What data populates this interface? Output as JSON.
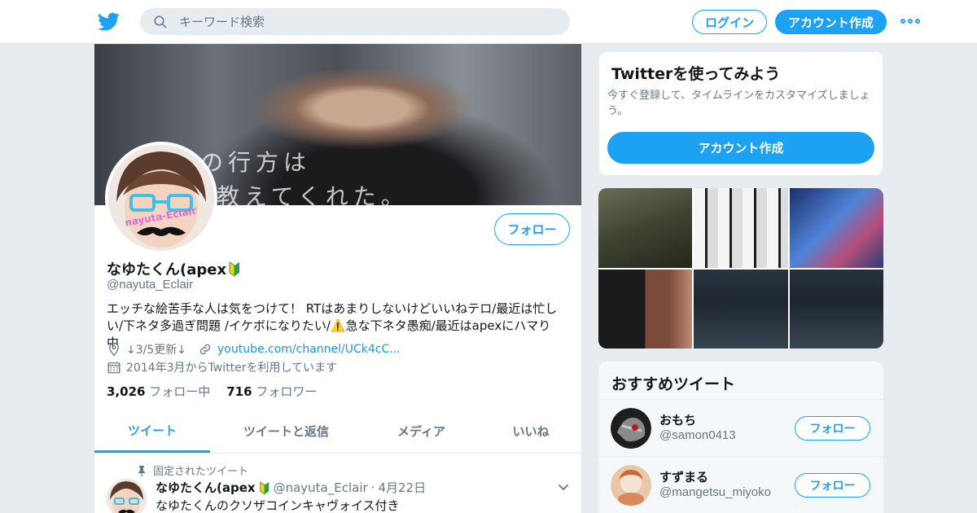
{
  "topbar": {
    "search_placeholder": "キーワード検索",
    "login_label": "ログイン",
    "signup_label": "アカウント作成"
  },
  "profile": {
    "banner_text_line1": "の行方は",
    "banner_text_line2": "教えてくれた。",
    "avatar_label": "nayuta-Eclair",
    "name": "なゆたくん(apex",
    "handle": "@nayuta_Eclair",
    "follow_label": "フォロー",
    "bio": "エッチな絵苦手な人は気をつけて！ RTはあまりしないけどいいねテロ/最近は忙しい/下ネタ多過ぎ問題 /イケボになりたい/⚠️急な下ネタ愚痴/最近はapexにハマり中",
    "location": "↓3/5更新↓",
    "website": "youtube.com/channel/UCk4cC...",
    "joined": "2014年3月からTwitterを利用しています",
    "following_count": "3,026",
    "following_label": "フォロー中",
    "followers_count": "716",
    "followers_label": "フォロワー"
  },
  "tabs": [
    {
      "label": "ツイート"
    },
    {
      "label": "ツイートと返信"
    },
    {
      "label": "メディア"
    },
    {
      "label": "いいね"
    }
  ],
  "pinned_tweet": {
    "pinned_label": "固定されたツイート",
    "author_name": "なゆたくん(apex",
    "author_handle": "@nayuta_Eclair",
    "date": "4月22日",
    "text": "なゆたくんのクソザコインキャヴォイス付き"
  },
  "signup_card": {
    "title": "Twitterを使ってみよう",
    "description": "今すぐ登録して、タイムラインをカスタマイズしましょう。",
    "button_label": "アカウント作成"
  },
  "recommended": {
    "title": "おすすめツイート",
    "follow_label": "フォロー",
    "users": [
      {
        "name": "おもち",
        "handle": "@samon0413"
      },
      {
        "name": "すずまる",
        "handle": "@mangetsu_miyoko"
      }
    ]
  },
  "colors": {
    "accent": "#1da1f2",
    "background": "#e6ecf0",
    "secondary_text": "#657786"
  }
}
